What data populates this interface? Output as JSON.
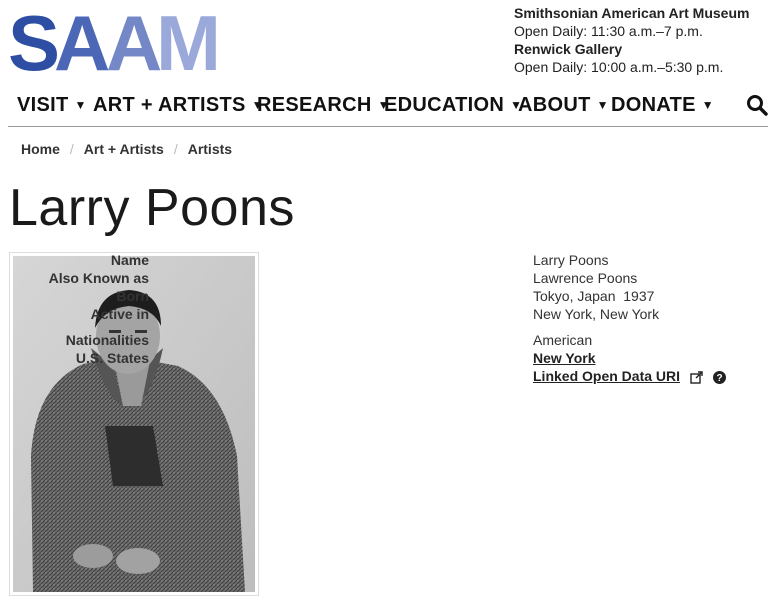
{
  "logo": {
    "text": "SAAM",
    "color_main": "#2d4ea3",
    "color_light": "#9aa9da"
  },
  "hours": [
    {
      "name": "Smithsonian American Art Museum",
      "hours": "Open Daily: 11:30 a.m.–7 p.m."
    },
    {
      "name": "Renwick Gallery",
      "hours": "Open Daily: 10:00 a.m.–5:30 p.m."
    }
  ],
  "nav": {
    "items": [
      "VISIT",
      "ART + ARTISTS",
      "RESEARCH",
      "EDUCATION",
      "ABOUT",
      "DONATE"
    ],
    "search_icon": "search-icon"
  },
  "breadcrumb": [
    "Home",
    "Art + Artists",
    "Artists"
  ],
  "page_title": "Larry Poons",
  "details": {
    "name_label": "Name",
    "name_value": "Larry Poons",
    "aka_label": "Also Known as",
    "aka_value": "Lawrence Poons",
    "born_label": "Born",
    "born_value": "Tokyo, Japan  1937",
    "active_label": "Active in",
    "active_value": "New York, New York",
    "nationalities_label": "Nationalities",
    "nationalities_value": "American",
    "states_label": "U.S. States",
    "states_value": "New York",
    "linked_data_label": "Linked Open Data URI"
  }
}
